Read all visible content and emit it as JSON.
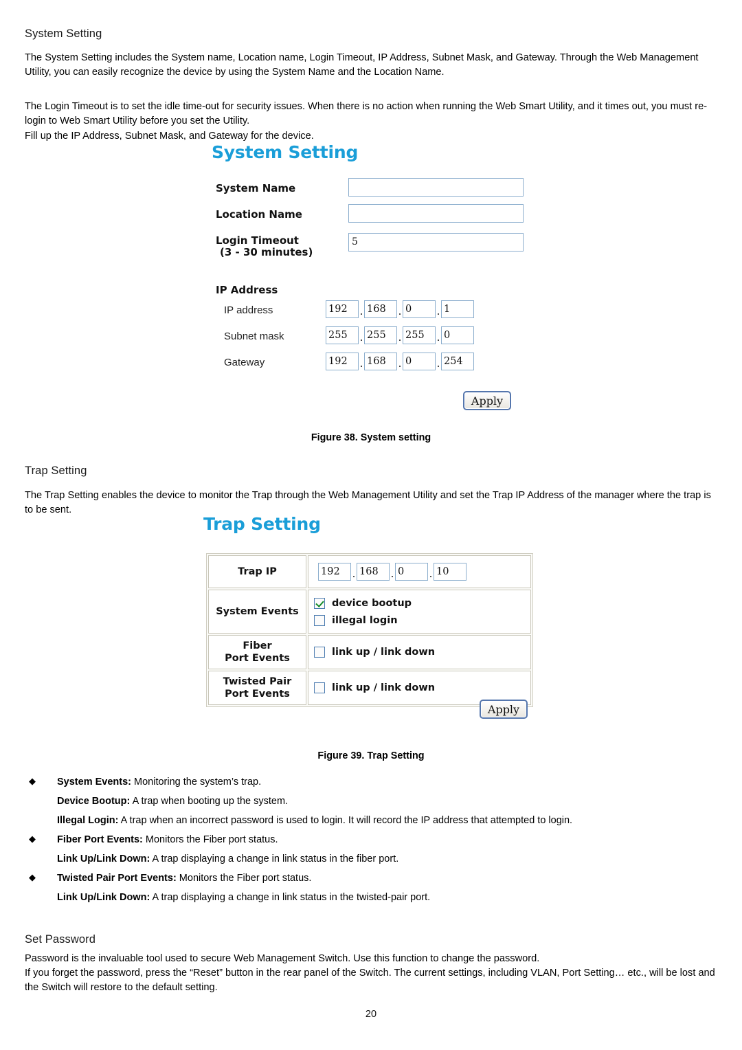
{
  "document": {
    "page_number": "20",
    "sections": [
      {
        "heading": "System Setting",
        "paragraphs": [
          "The System Setting includes the System name, Location name, Login Timeout, IP Address, Subnet Mask, and Gateway. Through the Web Management Utility, you can easily recognize the device by using the System Name and the Location Name.",
          "The Login Timeout is to set the idle time-out for security issues. When there is no action when running the Web Smart Utility, and it times out, you must re-login to Web Smart Utility before you set the Utility.",
          "Fill up the IP Address, Subnet Mask, and Gateway for the device."
        ]
      },
      {
        "heading": "Trap Setting",
        "paragraphs": [
          "The Trap Setting enables the device to monitor the Trap through the Web Management Utility and set the Trap IP Address of the manager where the trap is to be sent."
        ]
      },
      {
        "heading": "Set Password",
        "paragraphs": [
          "Password is the invaluable tool used to secure Web Management Switch. Use this function to change the password.",
          "If you forget the password, press the “Reset” button in the rear panel of the Switch. The current settings, including VLAN, Port Setting… etc., will be lost and the Switch will restore to the default setting."
        ]
      }
    ],
    "captions": {
      "figure_38": "Figure 38. System setting",
      "figure_39": "Figure 39. Trap Setting"
    },
    "bullets": [
      {
        "marker": "◆",
        "term": "System Events:",
        "text": " Monitoring the system’s trap."
      },
      {
        "marker": "",
        "term": "Device Bootup:",
        "text": " A trap when booting up the system."
      },
      {
        "marker": "",
        "term": "Illegal Login:",
        "text": " A trap when an incorrect password is used to login. It will record the IP address that attempted to login."
      },
      {
        "marker": "◆",
        "term": "Fiber Port Events:",
        "text": " Monitors the Fiber port status."
      },
      {
        "marker": "",
        "term": "Link Up/Link Down:",
        "text": " A trap displaying a change in link status in the fiber port."
      },
      {
        "marker": "◆",
        "term": "Twisted Pair Port Events:",
        "text": " Monitors the Fiber port status."
      },
      {
        "marker": "",
        "term": "Link Up/Link Down:",
        "text": " A trap displaying a change in link status in the twisted-pair port."
      }
    ]
  },
  "system_setting": {
    "title": "System Setting",
    "accent_color": "#1a9ed8",
    "fields": [
      {
        "label": "System Name",
        "sublabel": "",
        "value": "",
        "placeholder": ""
      },
      {
        "label": "Location Name",
        "sublabel": "",
        "value": "",
        "placeholder": ""
      },
      {
        "label": "Login Timeout",
        "sublabel": "(3 - 30 minutes)",
        "value": "5",
        "placeholder": ""
      }
    ],
    "ip_section_label": "IP Address",
    "ip_rows": [
      {
        "label": "IP address",
        "octets": [
          "192",
          "168",
          "0",
          "1"
        ]
      },
      {
        "label": "Subnet mask",
        "octets": [
          "255",
          "255",
          "255",
          "0"
        ]
      },
      {
        "label": "Gateway",
        "octets": [
          "192",
          "168",
          "0",
          "254"
        ]
      }
    ],
    "apply_label": "Apply"
  },
  "trap_setting": {
    "title": "Trap Setting",
    "accent_color": "#1a9ed8",
    "rows": [
      {
        "label": "Trap IP",
        "type": "ip",
        "octets": [
          "192",
          "168",
          "0",
          "10"
        ]
      },
      {
        "label": "System Events",
        "type": "checkboxes",
        "items": [
          {
            "label": "device bootup",
            "checked": true
          },
          {
            "label": "illegal login",
            "checked": false
          }
        ]
      },
      {
        "label": "Fiber\nPort Events",
        "label_line1": "Fiber",
        "label_line2": "Port Events",
        "type": "checkboxes",
        "items": [
          {
            "label": "link up / link down",
            "checked": false
          }
        ]
      },
      {
        "label": "Twisted Pair\nPort Events",
        "label_line1": "Twisted Pair",
        "label_line2": "Port Events",
        "type": "checkboxes",
        "items": [
          {
            "label": "link up / link down",
            "checked": false
          }
        ]
      }
    ],
    "apply_label": "Apply"
  }
}
